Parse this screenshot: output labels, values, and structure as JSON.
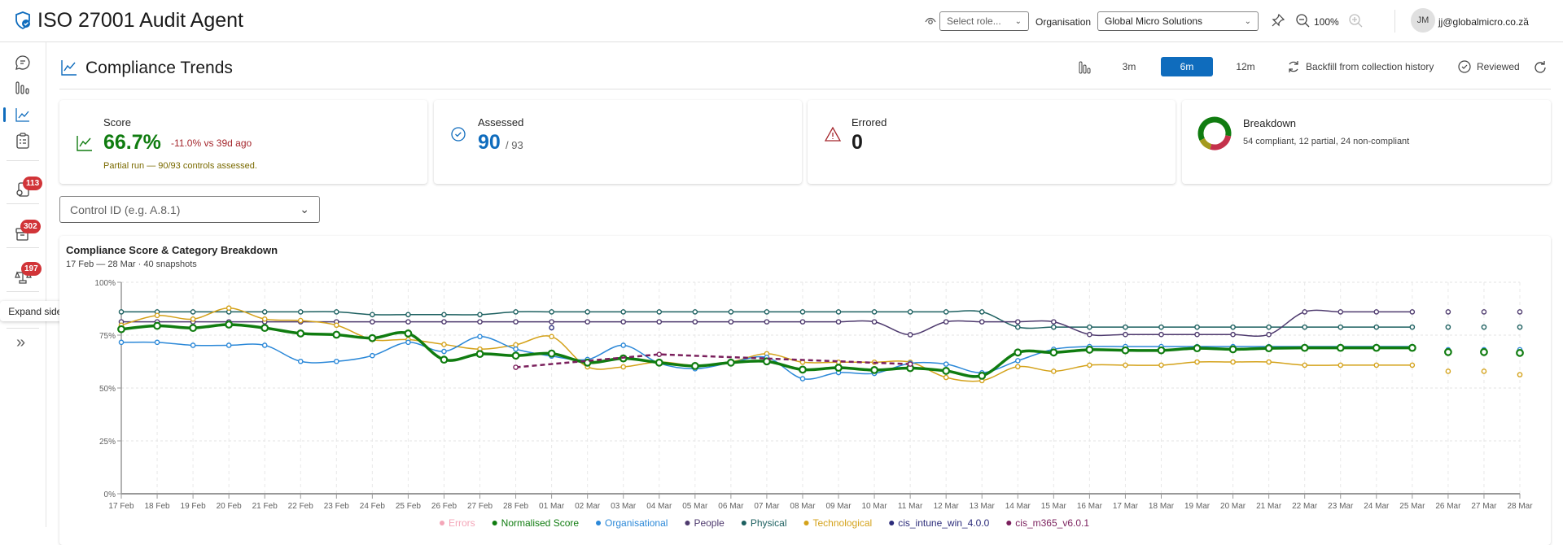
{
  "header": {
    "title": "ISO 27001 Audit Agent",
    "role_placeholder": "Select role...",
    "organisation_label": "Organisation",
    "organisation_value": "Global Micro Solutions",
    "zoom_level": "100%",
    "user_initials": "JM",
    "user_email": "jj@globalmicro.co.za"
  },
  "sidebar": {
    "items": [
      {
        "icon": "chat-icon"
      },
      {
        "icon": "bar-chart-icon"
      },
      {
        "icon": "trend-chart-icon",
        "active": true
      },
      {
        "icon": "clipboard-checklist-icon"
      },
      {
        "icon": "search-document-icon",
        "badge": "113"
      },
      {
        "icon": "archive-box-icon",
        "badge": "302"
      },
      {
        "icon": "scales-icon",
        "badge": "197"
      }
    ],
    "tooltip": "Expand sidebar"
  },
  "page": {
    "title": "Compliance Trends",
    "ranges": [
      "3m",
      "6m",
      "12m"
    ],
    "selected_range": "6m",
    "backfill_label": "Backfill from collection history",
    "reviewed_label": "Reviewed"
  },
  "cards": {
    "score": {
      "label": "Score",
      "value": "66.7%",
      "delta": "-11.0% vs 39d ago",
      "note": "Partial run — 90/93 controls assessed."
    },
    "assessed": {
      "label": "Assessed",
      "value": "90",
      "total": "/ 93"
    },
    "errored": {
      "label": "Errored",
      "value": "0"
    },
    "breakdown": {
      "label": "Breakdown",
      "text": "54 compliant, 12 partial, 24 non-compliant",
      "compliant": 54,
      "partial": 12,
      "non_compliant": 24,
      "colors": {
        "compliant": "#107c10",
        "partial": "#a49a1e",
        "non_compliant": "#c4314b"
      }
    }
  },
  "filter": {
    "placeholder": "Control ID (e.g. A.8.1)"
  },
  "colors": {
    "accent": "#0f6cbd",
    "score_green": "#107c10",
    "delta_red": "#a4262c",
    "note_olive": "#7a6a00"
  },
  "chart_data": {
    "type": "line",
    "title": "Compliance Score & Category Breakdown",
    "subtitle": "17 Feb — 28 Mar · 40 snapshots",
    "ylim": [
      0,
      100
    ],
    "yticks": [
      "0%",
      "25%",
      "50%",
      "75%",
      "100%"
    ],
    "grid": true,
    "legend": "bottom",
    "line_end": "25 Mar",
    "x": [
      "17 Feb",
      "18 Feb",
      "19 Feb",
      "20 Feb",
      "21 Feb",
      "22 Feb",
      "23 Feb",
      "24 Feb",
      "25 Feb",
      "26 Feb",
      "27 Feb",
      "28 Feb",
      "01 Mar",
      "02 Mar",
      "03 Mar",
      "04 Mar",
      "05 Mar",
      "06 Mar",
      "07 Mar",
      "08 Mar",
      "09 Mar",
      "10 Mar",
      "11 Mar",
      "12 Mar",
      "13 Mar",
      "14 Mar",
      "15 Mar",
      "16 Mar",
      "17 Mar",
      "18 Mar",
      "19 Mar",
      "20 Mar",
      "21 Mar",
      "22 Mar",
      "23 Mar",
      "24 Mar",
      "25 Mar",
      "26 Mar",
      "27 Mar",
      "28 Mar"
    ],
    "series": [
      {
        "name": "Errors",
        "color": "#f4a6b8",
        "values": []
      },
      {
        "name": "Normalised Score",
        "color": "#107c10",
        "thick": true,
        "values": [
          77.8,
          79.4,
          78.4,
          80,
          78.4,
          75.8,
          75.2,
          73.6,
          75.8,
          63.4,
          66.1,
          65.3,
          66.3,
          62,
          64,
          62,
          60.4,
          62,
          62.6,
          58.7,
          59.6,
          58.5,
          59.4,
          58.1,
          55.8,
          66.8,
          66.8,
          68.1,
          67.8,
          67.8,
          68.8,
          68.3,
          68.8,
          69,
          69,
          69,
          69,
          67,
          67,
          66.6
        ]
      },
      {
        "name": "Organisational",
        "color": "#2b88d8",
        "values": [
          71.6,
          71.6,
          70.2,
          70.2,
          70.2,
          62.6,
          62.6,
          65.3,
          71.6,
          67.3,
          74.3,
          68.4,
          65.1,
          63.5,
          70.2,
          61.7,
          59.1,
          62,
          64.5,
          54.4,
          57.3,
          56.9,
          61.7,
          61.3,
          57.2,
          62.9,
          68.3,
          69.6,
          69.6,
          69.6,
          69.6,
          69.6,
          69.6,
          69.6,
          69.6,
          69.6,
          69.6,
          68.1,
          68.1,
          68.1
        ]
      },
      {
        "name": "People",
        "color": "#4e3a6e",
        "values": [
          81.3,
          81.3,
          81.3,
          81.3,
          81.3,
          81.3,
          81.3,
          81.3,
          81.3,
          81.3,
          81.3,
          81.3,
          81.3,
          81.3,
          81.3,
          81.3,
          81.3,
          81.3,
          81.3,
          81.3,
          81.3,
          81.3,
          75.2,
          81.3,
          81.3,
          81.3,
          81.3,
          75.3,
          75.3,
          75.3,
          75.3,
          75.3,
          75.3,
          86,
          86,
          86,
          86,
          86,
          86,
          86
        ]
      },
      {
        "name": "Physical",
        "color": "#1d6060",
        "values": [
          86,
          86,
          86,
          86,
          86,
          86,
          86,
          84.7,
          84.7,
          84.7,
          84.7,
          86,
          86,
          86,
          86,
          86,
          86,
          86,
          86,
          86,
          86,
          86,
          86,
          86,
          86,
          78.8,
          78.8,
          78.8,
          78.8,
          78.8,
          78.8,
          78.8,
          78.8,
          78.8,
          78.8,
          78.8,
          78.8,
          78.8,
          78.8,
          78.8
        ]
      },
      {
        "name": "Technological",
        "color": "#d4a21a",
        "values": [
          79.7,
          84.3,
          82.6,
          87.8,
          82.6,
          81.9,
          79.7,
          72.9,
          72.9,
          70.6,
          68.4,
          70.4,
          74.3,
          60,
          60,
          62.3,
          60.7,
          62.3,
          66.2,
          62.2,
          62.2,
          62.2,
          62.2,
          55,
          53.5,
          60.1,
          57.9,
          60.8,
          60.8,
          60.8,
          62.3,
          62.3,
          62.3,
          60.8,
          60.8,
          60.8,
          60.8,
          57.9,
          57.9,
          56.3
        ]
      },
      {
        "name": "cis_intune_win_4.0.0",
        "color": "#2b2b7a",
        "points": [
          {
            "x": "01 Mar",
            "y": 78.5
          }
        ]
      },
      {
        "name": "cis_m365_v6.0.1",
        "color": "#7a1f5c",
        "dashed": true,
        "points": [
          {
            "x": "28 Feb",
            "y": 59.8
          },
          {
            "x": "04 Mar",
            "y": 65.9
          },
          {
            "x": "11 Mar",
            "y": 61.3
          }
        ]
      }
    ]
  }
}
